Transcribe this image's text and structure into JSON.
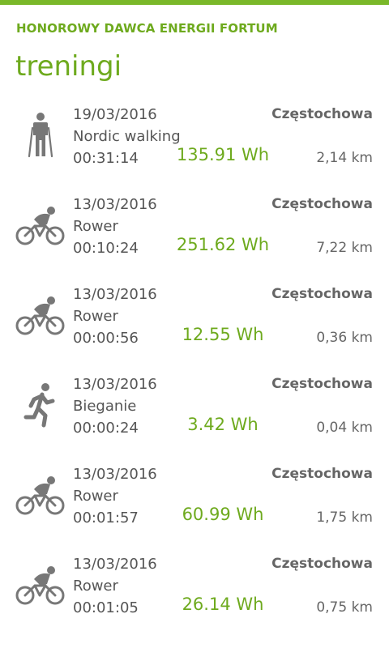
{
  "app": {
    "title": "HONOROWY DAWCA ENERGII FORTUM"
  },
  "page": {
    "title": "treningi"
  },
  "colors": {
    "accent": "#6eaa1e",
    "icon": "#777777",
    "text": "#555555"
  },
  "entries": [
    {
      "icon": "nordic-walking-icon",
      "date": "19/03/2016",
      "activity": "Nordic walking",
      "duration": "00:31:14",
      "city": "Częstochowa",
      "energy": "135.91 Wh",
      "distance": "2,14 km"
    },
    {
      "icon": "bike-icon",
      "date": "13/03/2016",
      "activity": "Rower",
      "duration": "00:10:24",
      "city": "Częstochowa",
      "energy": "251.62 Wh",
      "distance": "7,22 km"
    },
    {
      "icon": "bike-icon",
      "date": "13/03/2016",
      "activity": "Rower",
      "duration": "00:00:56",
      "city": "Częstochowa",
      "energy": "12.55 Wh",
      "distance": "0,36 km"
    },
    {
      "icon": "running-icon",
      "date": "13/03/2016",
      "activity": "Bieganie",
      "duration": "00:00:24",
      "city": "Częstochowa",
      "energy": "3.42 Wh",
      "distance": "0,04 km"
    },
    {
      "icon": "bike-icon",
      "date": "13/03/2016",
      "activity": "Rower",
      "duration": "00:01:57",
      "city": "Częstochowa",
      "energy": "60.99 Wh",
      "distance": "1,75 km"
    },
    {
      "icon": "bike-icon",
      "date": "13/03/2016",
      "activity": "Rower",
      "duration": "00:01:05",
      "city": "Częstochowa",
      "energy": "26.14 Wh",
      "distance": "0,75 km"
    }
  ]
}
